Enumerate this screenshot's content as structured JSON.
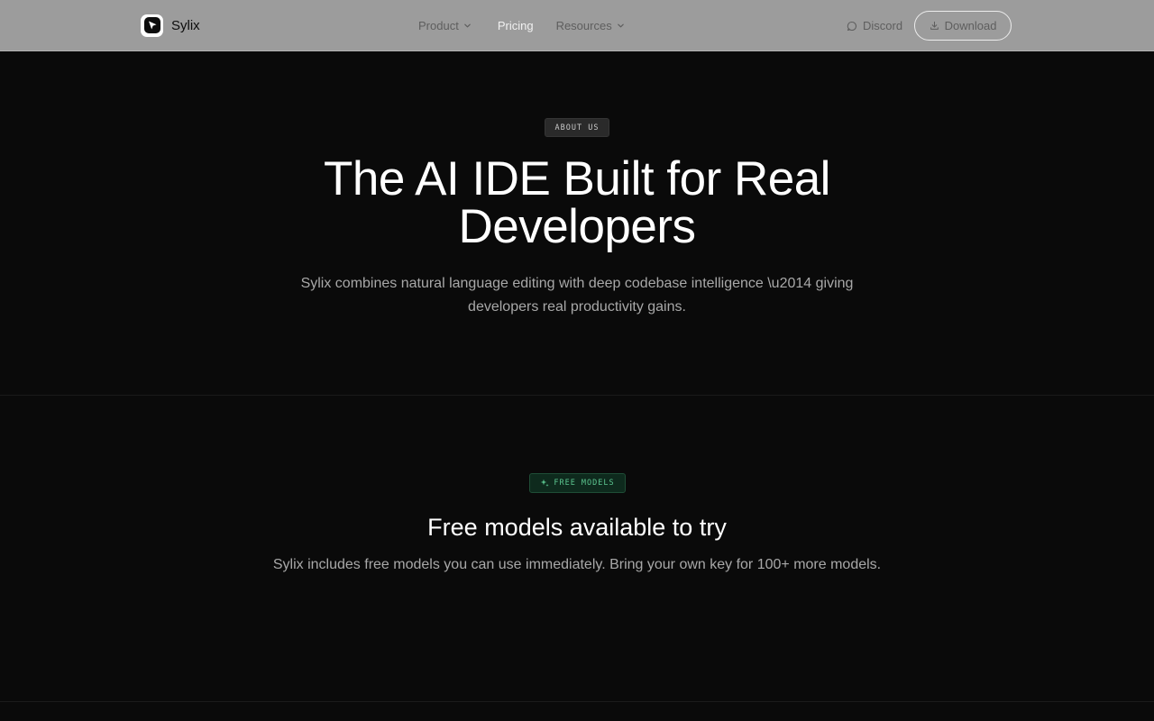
{
  "nav": {
    "brand": "Sylix",
    "items": [
      {
        "label": "Product"
      },
      {
        "label": "Pricing"
      },
      {
        "label": "Resources"
      }
    ],
    "discord_label": "Discord",
    "download_label": "Download"
  },
  "hero": {
    "badge": "ABOUT US",
    "title": "The AI IDE Built for Real Developers",
    "subtitle": "Sylix combines natural language editing with deep codebase intelligence \\u2014 giving developers real productivity gains."
  },
  "models": {
    "badge": "FREE MODELS",
    "title": "Free models available to try",
    "subtitle": "Sylix includes free models you can use immediately. Bring your own key for 100+ more models."
  },
  "icons": {
    "logo": "cursor-logo-icon",
    "nav_chevron": "chevron-down-icon",
    "discord": "chat-bubble-icon",
    "download": "download-icon",
    "free_models": "sparkles-icon"
  },
  "colors": {
    "page_bg": "#0a0a0a",
    "nav_bg": "#9c9c9c",
    "accent_green": "#5cc690",
    "muted_text": "#a8a8a8"
  }
}
